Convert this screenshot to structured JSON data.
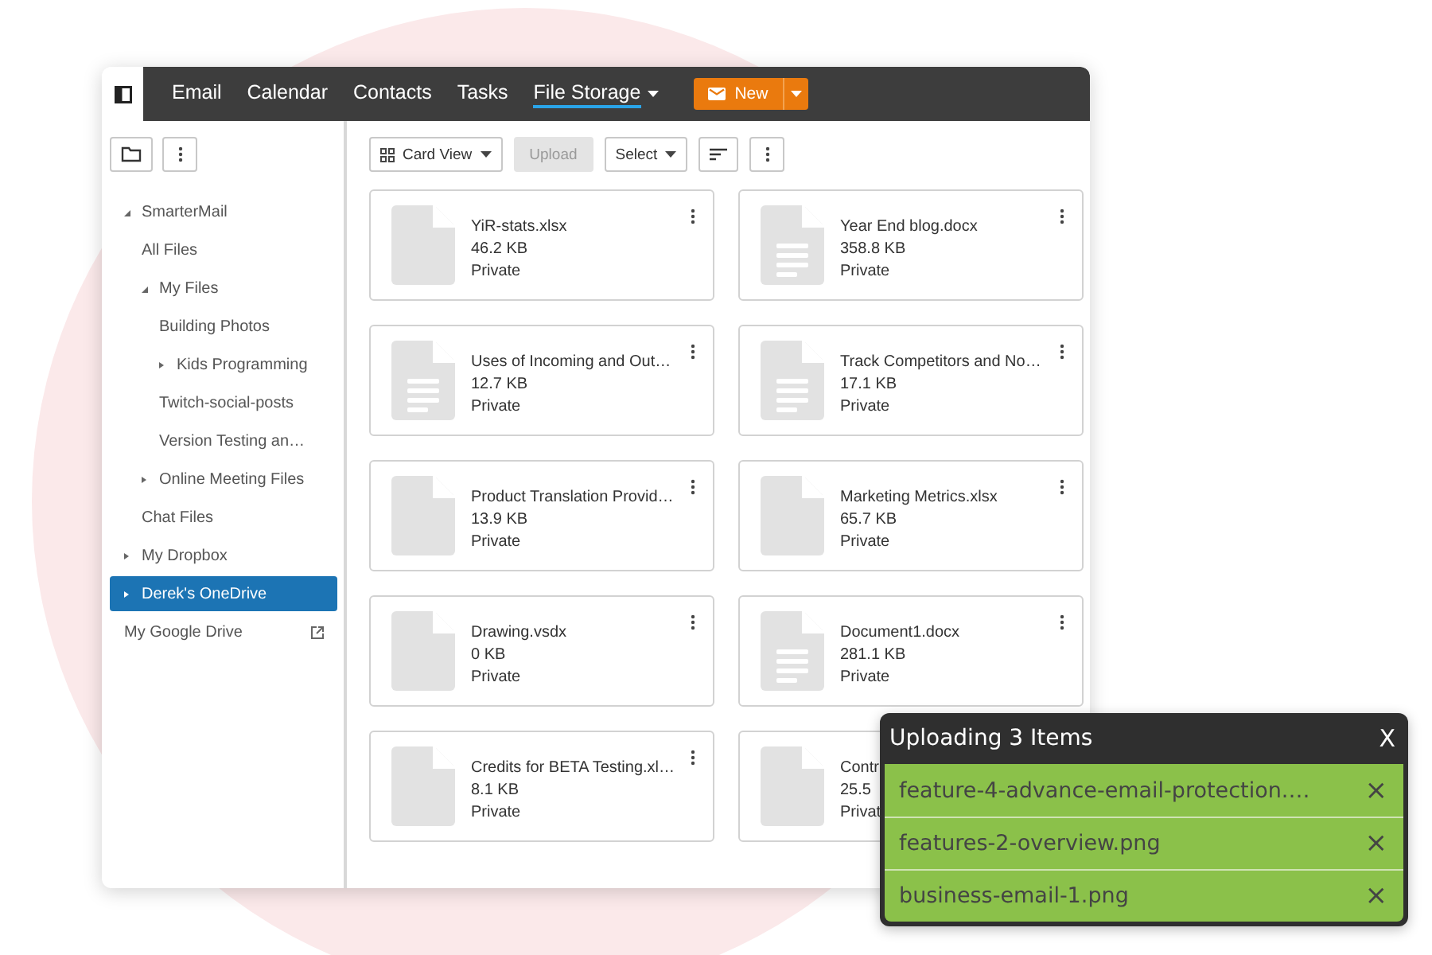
{
  "nav": {
    "tabs": [
      {
        "label": "Email",
        "selected": false,
        "dropdown": false
      },
      {
        "label": "Calendar",
        "selected": false,
        "dropdown": false
      },
      {
        "label": "Contacts",
        "selected": false,
        "dropdown": false
      },
      {
        "label": "Tasks",
        "selected": false,
        "dropdown": false
      },
      {
        "label": "File Storage",
        "selected": true,
        "dropdown": true
      }
    ],
    "new_button": "New"
  },
  "sidebar": {
    "items": [
      {
        "label": "SmarterMail",
        "selected": false,
        "expanded": true,
        "children": [
          {
            "label": "All Files",
            "selected": false
          },
          {
            "label": "My Files",
            "selected": false,
            "expanded": true,
            "children": [
              {
                "label": "Building Photos",
                "selected": false
              },
              {
                "label": "Kids Programming",
                "selected": false,
                "expanded": false
              },
              {
                "label": "Twitch-social-posts",
                "selected": false
              },
              {
                "label": "Version Testing an…",
                "selected": false
              }
            ]
          },
          {
            "label": "Online Meeting Files",
            "selected": false,
            "expanded": false
          },
          {
            "label": "Chat Files",
            "selected": false
          }
        ]
      },
      {
        "label": "My Dropbox",
        "selected": false,
        "expanded": false
      },
      {
        "label": "Derek's OneDrive",
        "selected": true,
        "expanded": false
      },
      {
        "label": "My Google Drive",
        "selected": false,
        "external": true
      }
    ]
  },
  "toolbar": {
    "view": "Card View",
    "upload": {
      "label": "Upload",
      "disabled": true
    },
    "select": "Select"
  },
  "files": [
    {
      "name": "YiR-stats.xlsx",
      "size": "46.2 KB",
      "sharing": "Private",
      "kind": "blank"
    },
    {
      "name": "Year End blog.docx",
      "size": "358.8 KB",
      "sharing": "Private",
      "kind": "text"
    },
    {
      "name": "Uses of Incoming and Out…",
      "size": "12.7 KB",
      "sharing": "Private",
      "kind": "text"
    },
    {
      "name": "Track Competitors and No…",
      "size": "17.1 KB",
      "sharing": "Private",
      "kind": "text"
    },
    {
      "name": "Product Translation Provid…",
      "size": "13.9 KB",
      "sharing": "Private",
      "kind": "blank"
    },
    {
      "name": "Marketing Metrics.xlsx",
      "size": "65.7 KB",
      "sharing": "Private",
      "kind": "blank"
    },
    {
      "name": "Drawing.vsdx",
      "size": "0 KB",
      "sharing": "Private",
      "kind": "blank"
    },
    {
      "name": "Document1.docx",
      "size": "281.1 KB",
      "sharing": "Private",
      "kind": "text"
    },
    {
      "name": "Credits for BETA Testing.xl…",
      "size": "8.1 KB",
      "sharing": "Private",
      "kind": "blank"
    },
    {
      "name": "Contr",
      "size": "25.5",
      "sharing": "Privat",
      "kind": "blank"
    }
  ],
  "upload_panel": {
    "title": "Uploading 3 Items",
    "close": "X",
    "items": [
      {
        "name": "feature-4-advance-email-protection.…",
        "remove": "×"
      },
      {
        "name": "features-2-overview.png",
        "remove": "×"
      },
      {
        "name": "business-email-1.png",
        "remove": "×"
      }
    ]
  }
}
